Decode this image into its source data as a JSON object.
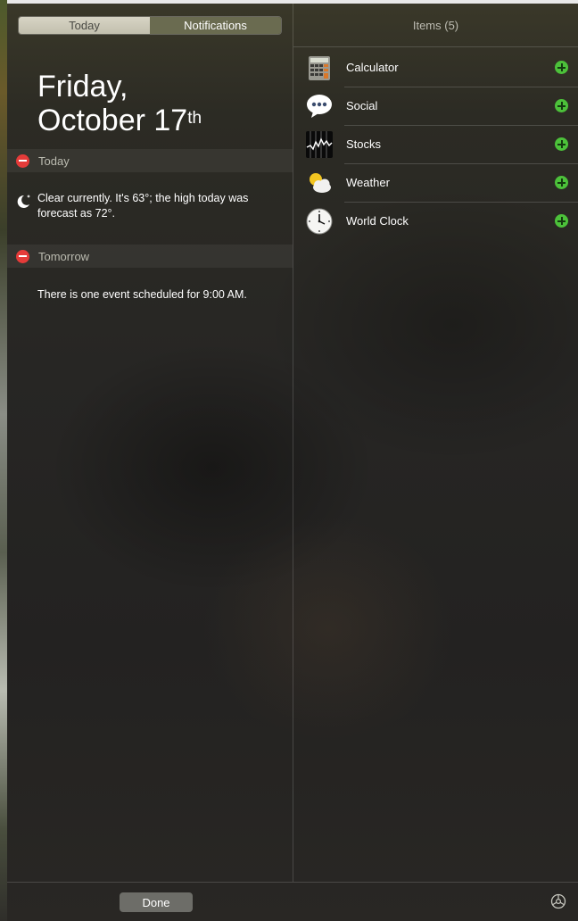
{
  "tabs": {
    "today": "Today",
    "notifications": "Notifications"
  },
  "date": {
    "line1": "Friday,",
    "line2": "October 17",
    "suffix": "th"
  },
  "sections": [
    {
      "title": "Today",
      "icon": "moon-icon",
      "text_line1": "Clear currently. It's 63°; the high today was",
      "text_line2": "forecast as 72°."
    },
    {
      "title": "Tomorrow",
      "text": "There is one event scheduled for 9:00 AM."
    }
  ],
  "items_title": "Items (5)",
  "items": [
    {
      "name": "Calculator",
      "icon": "calculator-icon"
    },
    {
      "name": "Social",
      "icon": "social-icon"
    },
    {
      "name": "Stocks",
      "icon": "stocks-icon"
    },
    {
      "name": "Weather",
      "icon": "weather-icon"
    },
    {
      "name": "World Clock",
      "icon": "world-clock-icon"
    }
  ],
  "done_label": "Done",
  "colors": {
    "remove": "#e53b39",
    "add": "#4cc13a"
  }
}
